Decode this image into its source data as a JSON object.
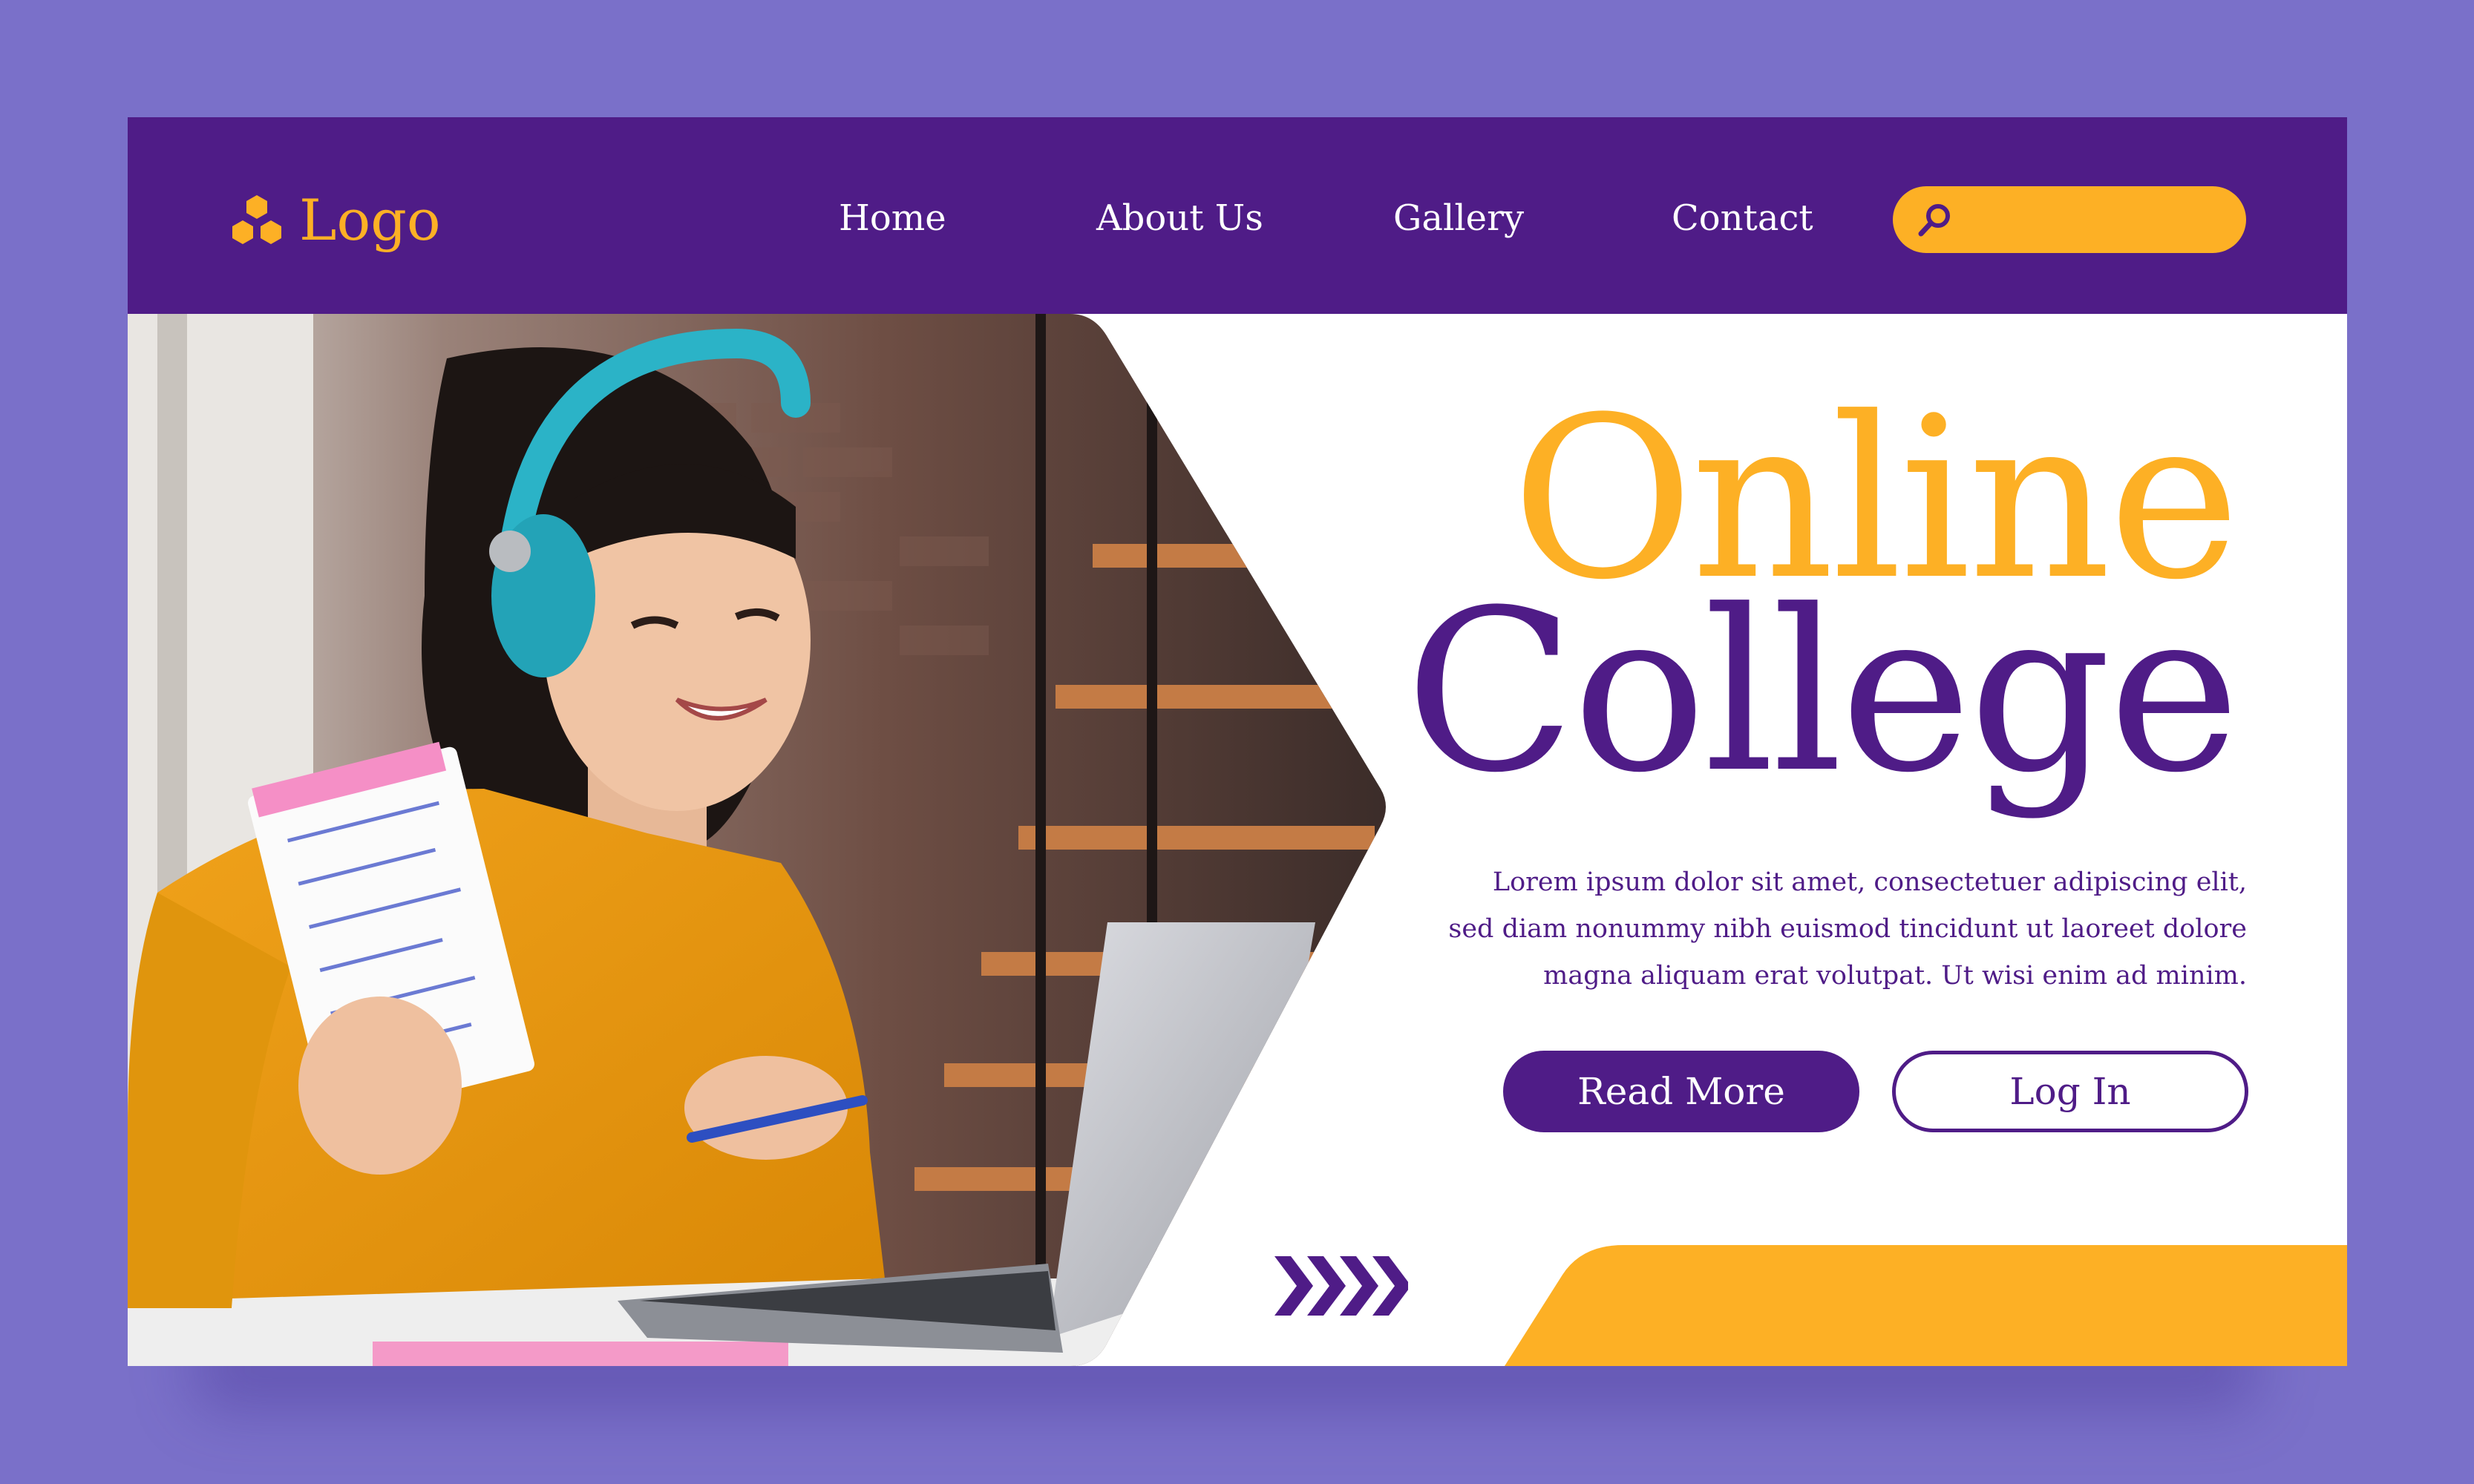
{
  "brand": {
    "logo_text": "Logo",
    "logo_icon": "hexagon-cluster-icon"
  },
  "nav": {
    "items": [
      {
        "label": "Home"
      },
      {
        "label": "About Us"
      },
      {
        "label": "Gallery"
      },
      {
        "label": "Contact"
      }
    ]
  },
  "search": {
    "icon": "search-icon",
    "value": "",
    "placeholder": ""
  },
  "hero": {
    "title_line1": "Online",
    "title_line2": "College",
    "description": "Lorem ipsum dolor sit amet, consectetuer adipiscing elit, sed diam nonummy nibh euismod tincidunt ut laoreet dolore magna aliquam erat volutpat. Ut wisi enim ad minim.",
    "read_more_label": "Read More",
    "login_label": "Log In",
    "image_subject": "student-with-headphones-and-laptop-photo"
  },
  "decor": {
    "arrows_icon": "chevron-right-icon"
  },
  "colors": {
    "page_background": "#7a70c9",
    "primary_purple": "#4f1c87",
    "accent_yellow": "#fdb025",
    "white": "#ffffff"
  }
}
